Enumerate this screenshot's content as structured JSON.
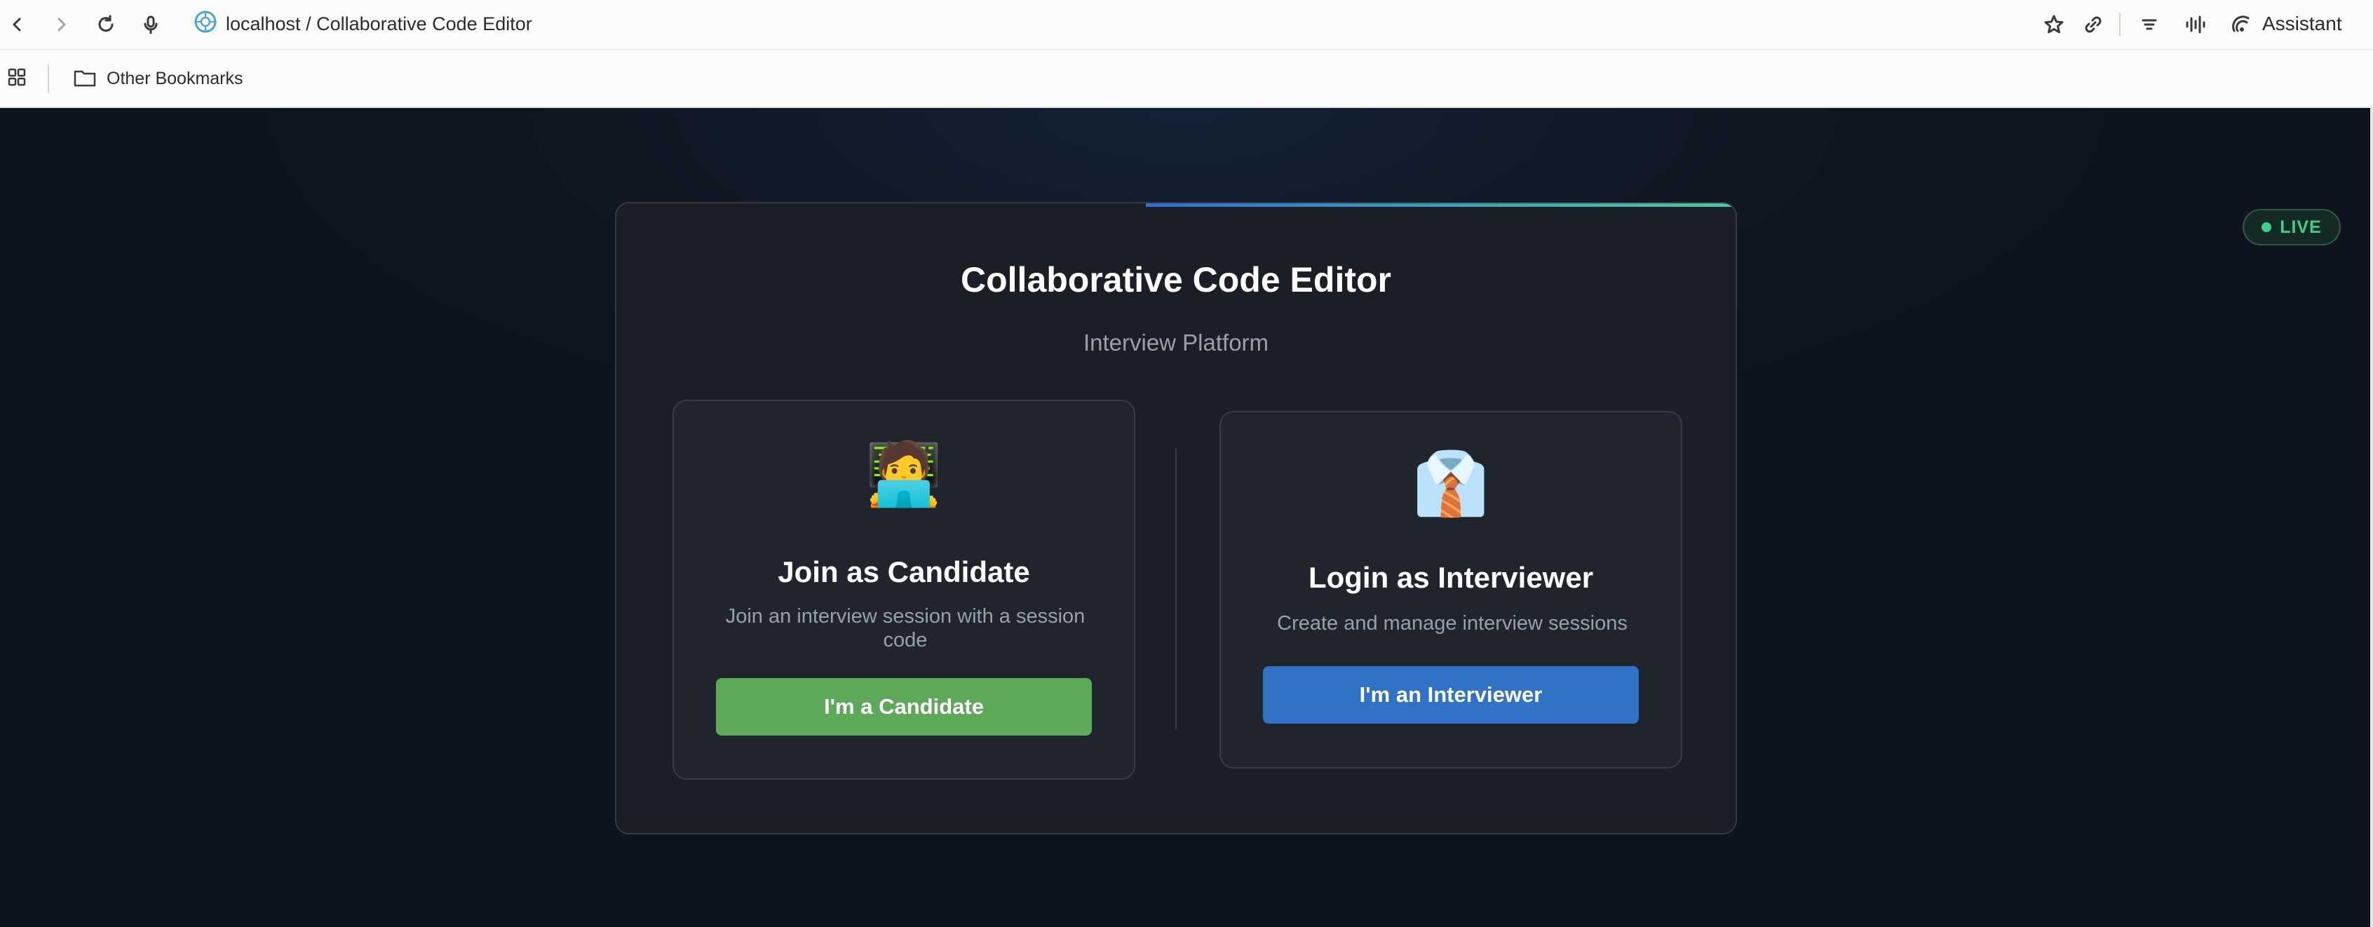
{
  "browser": {
    "url": "localhost / Collaborative Code Editor",
    "assistant_label": "Assistant",
    "bookmarks_label": "Other Bookmarks"
  },
  "app": {
    "title": "Collaborative Code Editor",
    "subtitle": "Interview Platform",
    "live_badge": "LIVE",
    "candidate": {
      "emoji": "🧑‍💻",
      "title": "Join as Candidate",
      "description": "Join an interview session with a session code",
      "button": "I'm a Candidate"
    },
    "interviewer": {
      "emoji": "👔",
      "title": "Login as Interviewer",
      "description": "Create and manage interview sessions",
      "button": "I'm an Interviewer"
    }
  },
  "colors": {
    "candidate_button": "#5ea85a",
    "interviewer_button": "#2f72c6",
    "live_green": "#3ecf8e",
    "background": "#0f1722"
  }
}
